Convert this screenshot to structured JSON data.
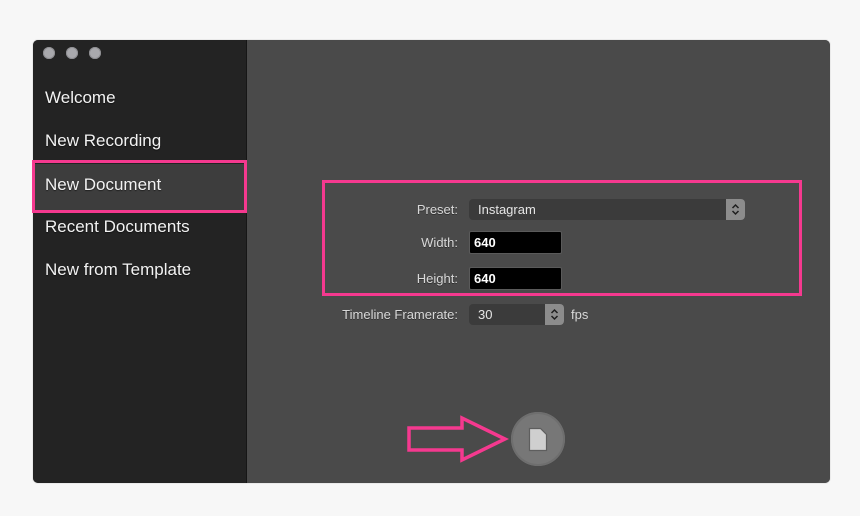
{
  "window": {
    "traffic_lights": [
      "close-button",
      "minimize-button",
      "zoom-button"
    ]
  },
  "sidebar": {
    "items": [
      {
        "label": "Welcome",
        "selected": false
      },
      {
        "label": "New Recording",
        "selected": false
      },
      {
        "label": "New Document",
        "selected": true
      },
      {
        "label": "Recent Documents",
        "selected": false
      },
      {
        "label": "New from Template",
        "selected": false
      }
    ]
  },
  "form": {
    "preset": {
      "label": "Preset:",
      "value": "Instagram"
    },
    "width": {
      "label": "Width:",
      "value": "640"
    },
    "height": {
      "label": "Height:",
      "value": "640"
    },
    "framerate": {
      "label": "Timeline Framerate:",
      "value": "30",
      "unit": "fps"
    }
  },
  "create_button": {
    "icon": "document-icon"
  },
  "annotations": {
    "highlight_color": "#f5398f",
    "arrow": "arrow-right-outline"
  },
  "colors": {
    "sidebar_bg": "#232323",
    "main_bg": "#4a4a4a",
    "page_bg": "#f7f7f7",
    "accent": "#f5398f"
  }
}
